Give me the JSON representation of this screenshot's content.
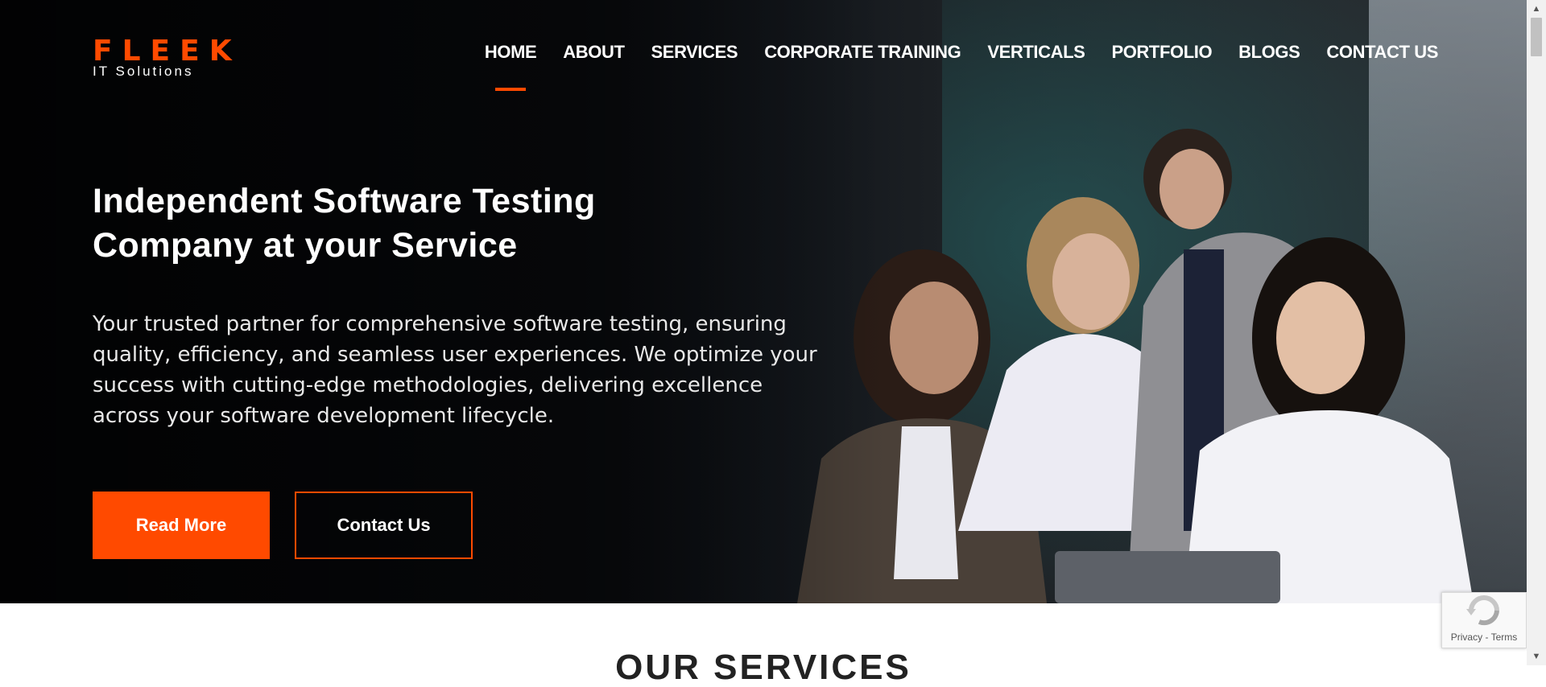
{
  "brand": {
    "logo_main": "FLEEK",
    "logo_sub": "IT Solutions",
    "accent_color": "#ff4a00"
  },
  "nav": {
    "items": [
      {
        "label": "HOME",
        "active": true
      },
      {
        "label": "ABOUT",
        "active": false
      },
      {
        "label": "SERVICES",
        "active": false
      },
      {
        "label": "CORPORATE TRAINING",
        "active": false
      },
      {
        "label": "VERTICALS",
        "active": false
      },
      {
        "label": "PORTFOLIO",
        "active": false
      },
      {
        "label": "BLOGS",
        "active": false
      },
      {
        "label": "CONTACT US",
        "active": false
      }
    ]
  },
  "hero": {
    "headline_line1": "Independent Software Testing",
    "headline_line2": "Company at your Service",
    "subtext": "Your trusted partner for comprehensive software testing, ensuring quality, efficiency, and seamless user experiences. We optimize your success with cutting-edge methodologies, delivering excellence across your software development lifecycle.",
    "primary_button": "Read More",
    "secondary_button": "Contact Us"
  },
  "services": {
    "title": "OUR SERVICES"
  },
  "recaptcha": {
    "privacy": "Privacy",
    "separator": " - ",
    "terms": "Terms"
  }
}
